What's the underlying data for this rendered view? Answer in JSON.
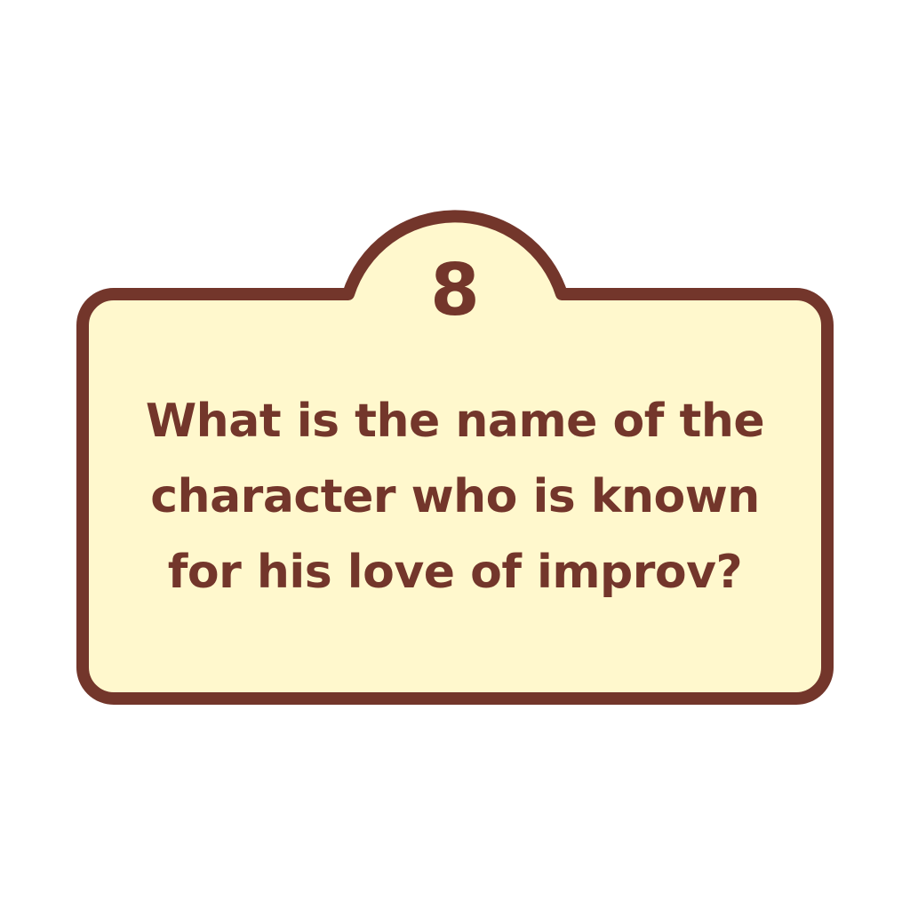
{
  "card": {
    "number": "8",
    "question_lines": [
      "What is the name of the",
      "character who is known",
      "for his love of improv?"
    ]
  },
  "colors": {
    "card_fill": "#fff8cd",
    "card_border": "#73362b",
    "text": "#73362b",
    "background": "#ffffff"
  }
}
